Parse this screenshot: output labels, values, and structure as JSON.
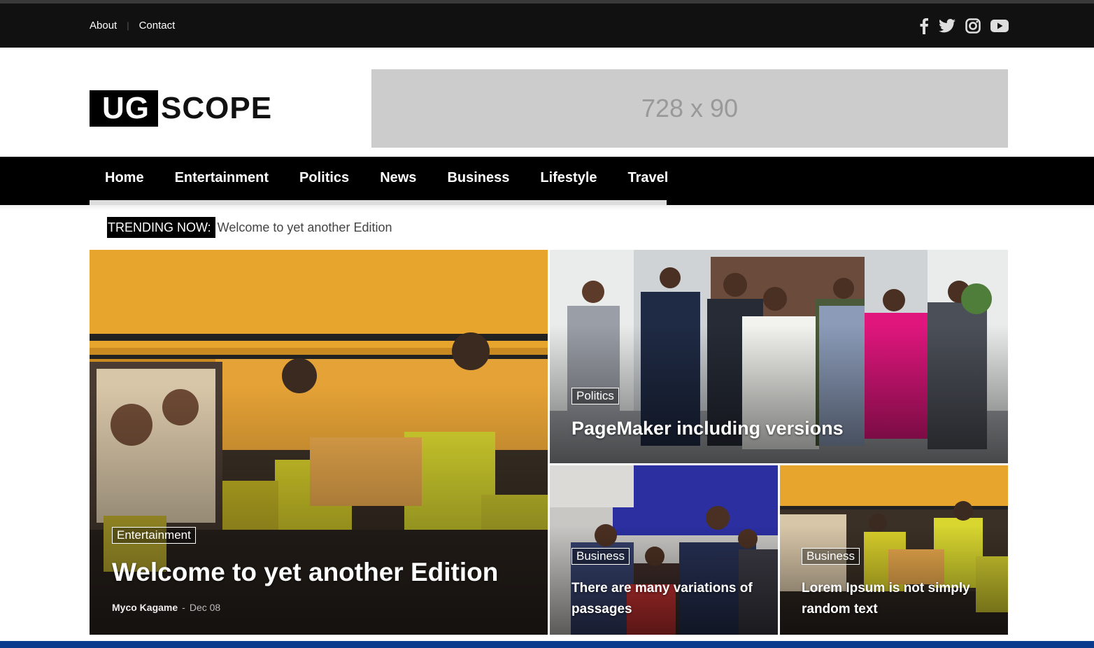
{
  "topbar": {
    "links": [
      "About",
      "Contact"
    ],
    "social_icons": [
      "facebook-icon",
      "twitter-icon",
      "instagram-icon",
      "youtube-icon"
    ]
  },
  "logo": {
    "part1": "UG",
    "part2": "SCOPE"
  },
  "ad": {
    "label": "728 x 90"
  },
  "nav": {
    "items": [
      "Home",
      "Entertainment",
      "Politics",
      "News",
      "Business",
      "Lifestyle",
      "Travel"
    ]
  },
  "trending": {
    "label": "TRENDING NOW:",
    "text": "Welcome to yet another Edition"
  },
  "featured": {
    "main": {
      "category": "Entertainment",
      "title": "Welcome to yet another Edition",
      "author": "Myco Kagame",
      "date": "Dec 08"
    },
    "top_right": {
      "category": "Politics",
      "title": "PageMaker including versions"
    },
    "bottom_left": {
      "category": "Business",
      "title": "There are many variations of passages"
    },
    "bottom_right": {
      "category": "Business",
      "title": "Lorem Ipsum is not simply random text"
    }
  },
  "colors": {
    "topbar": "#111111",
    "navbar": "#000000",
    "ad_placeholder": "#cccccc",
    "footer_strip": "#0a3b8c"
  }
}
